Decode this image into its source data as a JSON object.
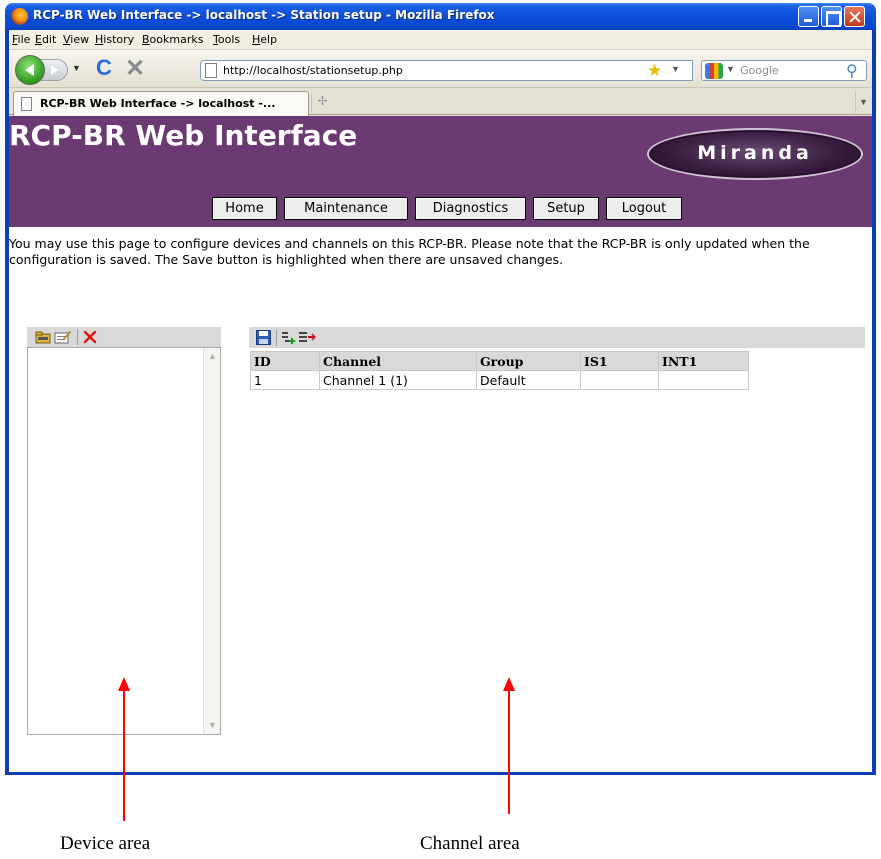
{
  "window": {
    "title": "RCP-BR Web Interface -> localhost -> Station setup - Mozilla Firefox"
  },
  "menu": [
    "File",
    "Edit",
    "View",
    "History",
    "Bookmarks",
    "Tools",
    "Help"
  ],
  "navbar": {
    "url": "http://localhost/stationsetup.php",
    "search_placeholder": "Google"
  },
  "tab": {
    "label": "RCP-BR Web Interface -> localhost -..."
  },
  "page": {
    "app_title": "RCP-BR Web Interface",
    "logo_text": "Miranda",
    "nav": [
      "Home",
      "Maintenance",
      "Diagnostics",
      "Setup",
      "Logout"
    ],
    "intro": "You may use this page to configure devices and channels on this RCP-BR. Please note that the RCP-BR is only updated when the configuration is saved. The Save button is highlighted when there are unsaved changes."
  },
  "channel_table": {
    "headers": [
      "ID",
      "Channel",
      "Group",
      "IS1",
      "INT1"
    ],
    "rows": [
      [
        "1",
        "Channel 1 (1)",
        "Default",
        "",
        ""
      ]
    ]
  },
  "annotations": {
    "device_area": "Device area",
    "channel_area": "Channel area"
  },
  "icons": {
    "toolbar": [
      "back-icon",
      "forward-icon",
      "reload-icon",
      "stop-icon",
      "page-icon",
      "bookmark-star-icon",
      "google-icon",
      "search-icon"
    ],
    "device": [
      "add-device-icon",
      "edit-device-icon",
      "delete-device-icon"
    ],
    "channel": [
      "save-icon",
      "add-channel-icon",
      "remove-channel-icon"
    ]
  },
  "colors": {
    "header_bg": "#6c3a73",
    "annotation_arrow": "#ff0000",
    "titlebar": "#0a48d0"
  }
}
